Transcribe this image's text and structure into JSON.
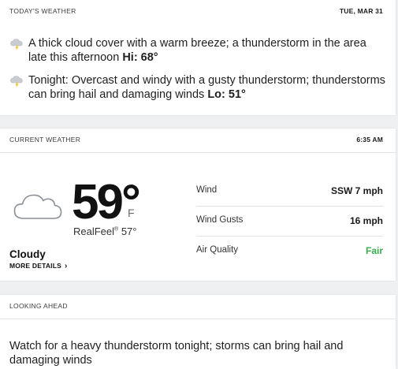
{
  "today": {
    "title": "TODAY'S WEATHER",
    "date": "TUE, MAR 31",
    "day_text": "A thick cloud cover with a warm breeze; a thunderstorm in the area late this afternoon",
    "day_hilo": "Hi: 68°",
    "night_text": "Tonight: Overcast and windy with a gusty thunderstorm; thunderstorms can bring hail and damaging winds",
    "night_hilo": "Lo: 51°"
  },
  "current": {
    "title": "CURRENT WEATHER",
    "time": "6:35 AM",
    "temperature": "59°",
    "unit": "F",
    "realfeel_label": "RealFeel",
    "realfeel_trademark": "®",
    "realfeel_value": "57°",
    "condition": "Cloudy",
    "more_details": "MORE DETAILS",
    "details": [
      {
        "label": "Wind",
        "value": "SSW 7 mph"
      },
      {
        "label": "Wind Gusts",
        "value": "16 mph"
      },
      {
        "label": "Air Quality",
        "value": "Fair"
      }
    ]
  },
  "ahead": {
    "title": "LOOKING AHEAD",
    "text": "Watch for a heavy thunderstorm tonight; storms can bring hail and damaging winds"
  },
  "icons": {
    "day": "thunderstorm-icon",
    "night": "thunderstorm-icon",
    "current": "cloud-icon"
  },
  "colors": {
    "air_quality_good": "#3aad4f",
    "background": "#eef0f2"
  }
}
